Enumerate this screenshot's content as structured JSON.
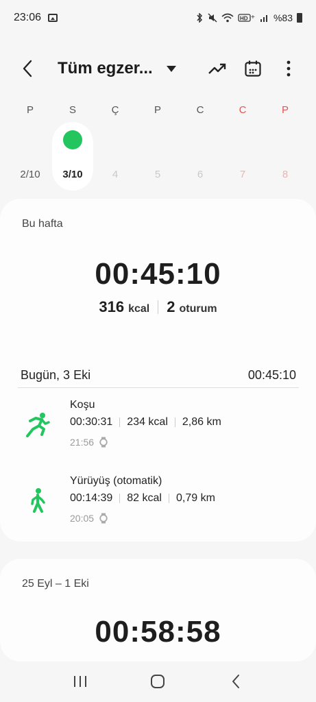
{
  "status_bar": {
    "time": "23:06",
    "battery": "%83"
  },
  "app_bar": {
    "title": "Tüm egzer..."
  },
  "week": {
    "days": [
      {
        "letter": "P",
        "date": "2/10",
        "weekend": false,
        "state": "past"
      },
      {
        "letter": "S",
        "date": "3/10",
        "weekend": false,
        "state": "active"
      },
      {
        "letter": "Ç",
        "date": "4",
        "weekend": false,
        "state": "future"
      },
      {
        "letter": "P",
        "date": "5",
        "weekend": false,
        "state": "future"
      },
      {
        "letter": "C",
        "date": "6",
        "weekend": false,
        "state": "future"
      },
      {
        "letter": "C",
        "date": "7",
        "weekend": true,
        "state": "future"
      },
      {
        "letter": "P",
        "date": "8",
        "weekend": true,
        "state": "future"
      }
    ],
    "accent_color": "#22c55e",
    "weekend_color": "#e25454"
  },
  "this_week": {
    "label": "Bu hafta",
    "total_time": "00:45:10",
    "kcal_value": "316",
    "kcal_unit": "kcal",
    "sessions_value": "2",
    "sessions_unit": "oturum"
  },
  "today": {
    "label": "Bugün, 3 Eki",
    "total": "00:45:10",
    "workouts": [
      {
        "name": "Koşu",
        "icon": "running-icon",
        "duration": "00:30:31",
        "kcal": "234 kcal",
        "distance": "2,86 km",
        "time": "21:56"
      },
      {
        "name": "Yürüyüş (otomatik)",
        "icon": "walking-icon",
        "duration": "00:14:39",
        "kcal": "82 kcal",
        "distance": "0,79 km",
        "time": "20:05"
      }
    ]
  },
  "previous_week": {
    "label": "25 Eyl – 1 Eki",
    "total_time": "00:58:58"
  }
}
